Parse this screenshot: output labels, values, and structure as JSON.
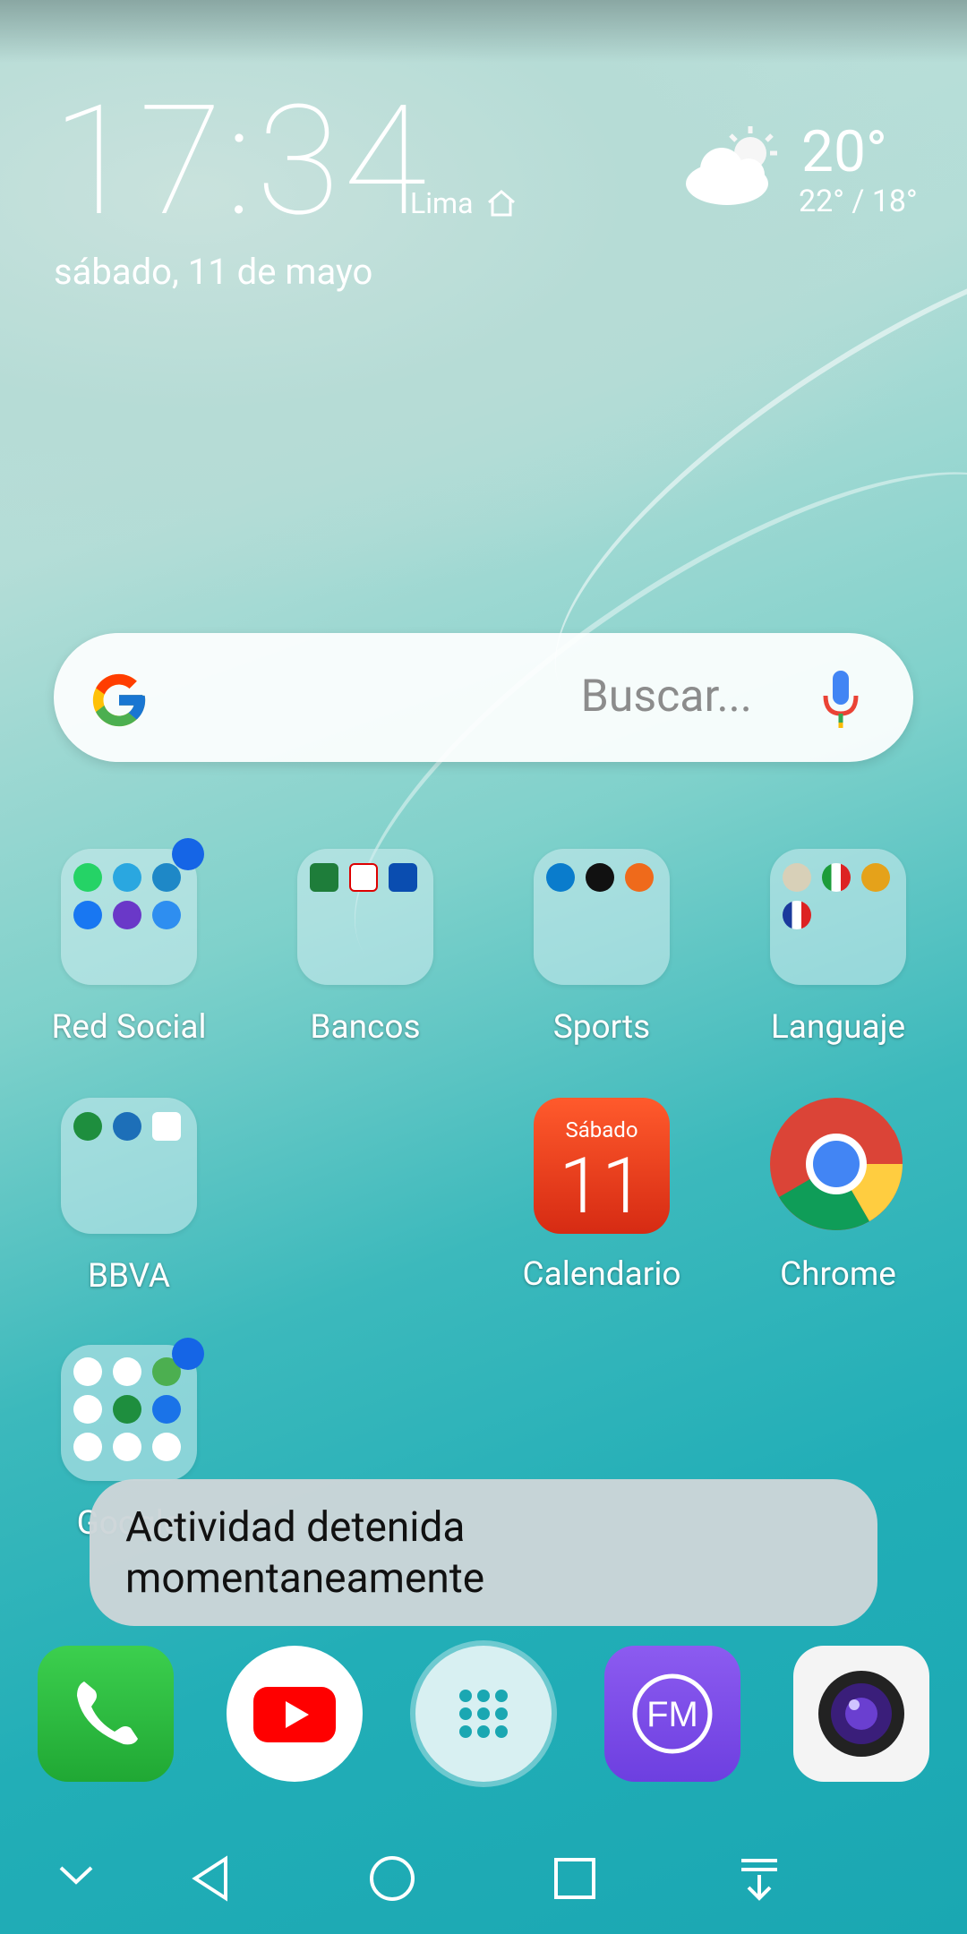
{
  "clock": {
    "time": "17:34",
    "city": "Lima",
    "date": "sábado, 11 de mayo"
  },
  "weather": {
    "temp": "20°",
    "range": "22° / 18°",
    "icon": "partly-cloudy-icon"
  },
  "search": {
    "placeholder": "Buscar..."
  },
  "folders": [
    {
      "label": "Red Social",
      "badge": true
    },
    {
      "label": "Bancos",
      "badge": false
    },
    {
      "label": "Sports",
      "badge": false
    },
    {
      "label": "Languaje",
      "badge": false
    },
    {
      "label": "BBVA",
      "badge": false
    },
    {
      "label": "Google",
      "badge": true
    }
  ],
  "apps": {
    "calendar": {
      "day_name": "Sábado",
      "day": "11",
      "label": "Calendario"
    },
    "chrome": {
      "label": "Chrome"
    }
  },
  "toast": {
    "line1": "Actividad detenida",
    "line2": "momentaneamente"
  },
  "dock": [
    "phone-icon",
    "youtube-icon",
    "app-drawer-icon",
    "fm-radio-icon",
    "camera-icon"
  ],
  "navbar": [
    "chevron-down-icon",
    "back-icon",
    "home-icon",
    "recents-icon",
    "notification-pull-icon"
  ],
  "colors": {
    "accent": "#1aa7b2",
    "badge": "#1565e6",
    "toast_bg": "#cdd5d8"
  }
}
